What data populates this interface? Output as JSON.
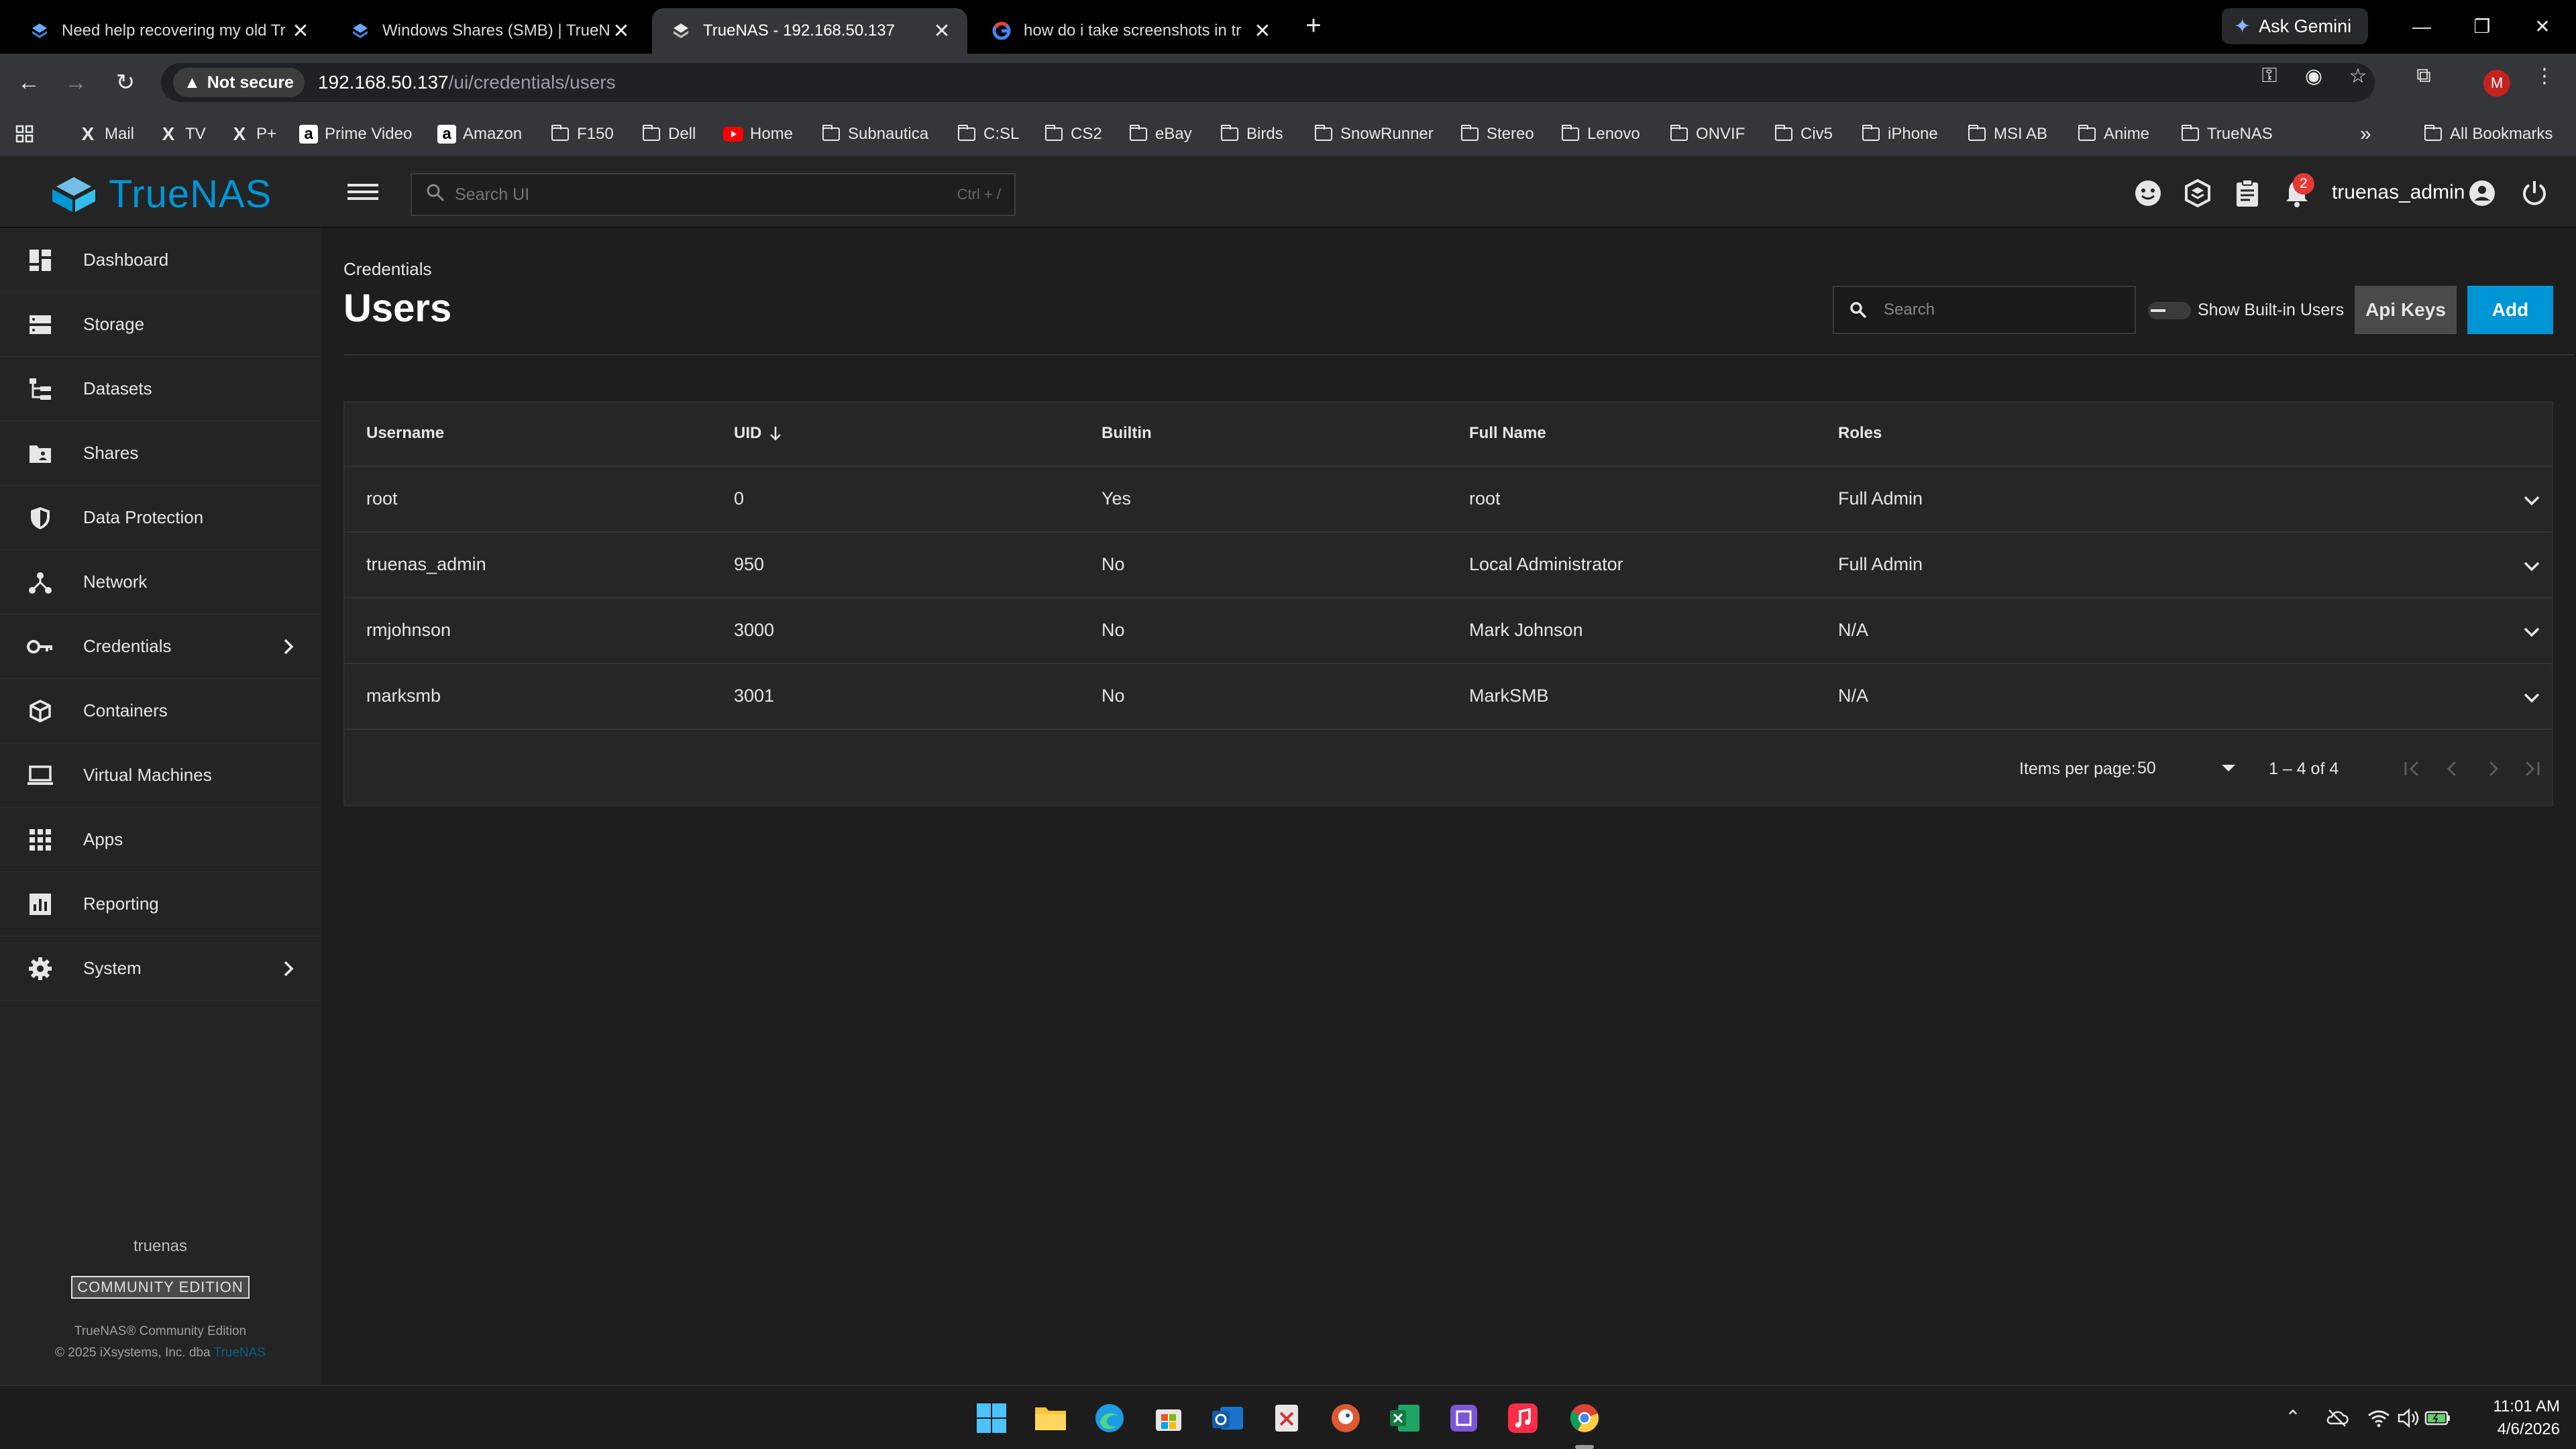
{
  "browser": {
    "tabs": [
      {
        "title": "Need help recovering my old Tr",
        "close": "✕"
      },
      {
        "title": "Windows Shares (SMB) | TrueN",
        "close": "✕"
      },
      {
        "title": "TrueNAS - 192.168.50.137",
        "close": "✕"
      },
      {
        "title": "how do i take screenshots in tr",
        "close": "✕"
      }
    ],
    "new_tab": "+",
    "gemini_label": "Ask Gemini",
    "address": {
      "security": "Not secure",
      "host": "192.168.50.137",
      "path": "/ui/credentials/users"
    },
    "profile_initial": "M",
    "bookmarks": [
      "Mail",
      "TV",
      "P+",
      "Prime Video",
      "Amazon",
      "F150",
      "Dell",
      "Home",
      "Subnautica",
      "C:SL",
      "CS2",
      "eBay",
      "Birds",
      "SnowRunner",
      "Stereo",
      "Lenovo",
      "ONVIF",
      "Civ5",
      "iPhone",
      "MSI AB",
      "Anime",
      "TrueNAS"
    ],
    "all_bookmarks": "All Bookmarks",
    "more": "»"
  },
  "header": {
    "brand": "TrueNAS",
    "search_placeholder": "Search UI",
    "search_shortcut": "Ctrl + /",
    "notification_count": "2",
    "username": "truenas_admin"
  },
  "sidebar": {
    "items": [
      {
        "label": "Dashboard",
        "icon": "dashboard-icon"
      },
      {
        "label": "Storage",
        "icon": "storage-icon"
      },
      {
        "label": "Datasets",
        "icon": "datasets-icon"
      },
      {
        "label": "Shares",
        "icon": "shares-icon"
      },
      {
        "label": "Data Protection",
        "icon": "shield-icon"
      },
      {
        "label": "Network",
        "icon": "network-icon"
      },
      {
        "label": "Credentials",
        "icon": "key-icon"
      },
      {
        "label": "Containers",
        "icon": "cube-icon"
      },
      {
        "label": "Virtual Machines",
        "icon": "monitor-icon"
      },
      {
        "label": "Apps",
        "icon": "apps-grid-icon"
      },
      {
        "label": "Reporting",
        "icon": "chart-icon"
      },
      {
        "label": "System",
        "icon": "gear-icon"
      }
    ],
    "hostname": "truenas",
    "edition": "COMMUNITY EDITION",
    "footer_line1": "TrueNAS® Community Edition",
    "footer_copyright": "© 2025 iXsystems, Inc. dba",
    "footer_link": "TrueNAS"
  },
  "main": {
    "breadcrumb": "Credentials",
    "title": "Users",
    "search_placeholder": "Search",
    "toggle_label": "Show Built-in Users",
    "api_keys_label": "Api Keys",
    "add_label": "Add",
    "table": {
      "columns": [
        "Username",
        "UID",
        "Builtin",
        "Full Name",
        "Roles"
      ],
      "rows": [
        {
          "username": "root",
          "uid": "0",
          "builtin": "Yes",
          "full_name": "root",
          "roles": "Full Admin"
        },
        {
          "username": "truenas_admin",
          "uid": "950",
          "builtin": "No",
          "full_name": "Local Administrator",
          "roles": "Full Admin"
        },
        {
          "username": "rmjohnson",
          "uid": "3000",
          "builtin": "No",
          "full_name": "Mark Johnson",
          "roles": "N/A"
        },
        {
          "username": "marksmb",
          "uid": "3001",
          "builtin": "No",
          "full_name": "MarkSMB",
          "roles": "N/A"
        }
      ]
    },
    "pagination": {
      "items_per_page_label": "Items per page:",
      "items_per_page": "50",
      "range": "1 – 4 of 4"
    }
  },
  "taskbar": {
    "time": "11:01 AM",
    "date": "4/6/2026"
  },
  "colors": {
    "accent": "#0095d5",
    "background": "#1e1e1e",
    "panel": "#242424"
  }
}
